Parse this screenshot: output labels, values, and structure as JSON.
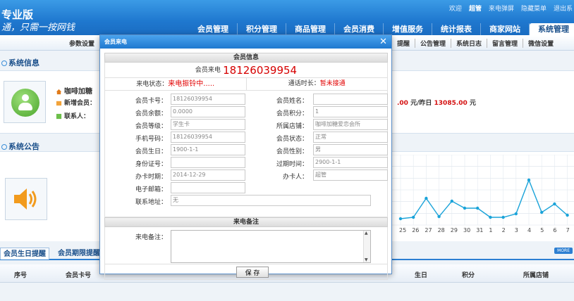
{
  "header": {
    "edition": "专业版",
    "slogan": "通，只需一按网钱",
    "top_links": {
      "welcome": "欢迎",
      "user": "超管",
      "call_popup": "来电弹屏",
      "hide_menu": "隐藏菜单",
      "logout": "退出系"
    },
    "nav": [
      "会员管理",
      "积分管理",
      "商品管理",
      "会员消费",
      "增值服务",
      "统计报表",
      "商家网站",
      "系统管理"
    ],
    "active_nav": "系统管理"
  },
  "subnav": {
    "left": "参数设置",
    "right": [
      "提醒",
      "公告管理",
      "系统日志",
      "留言管理",
      "微信设置"
    ]
  },
  "system_info": {
    "title": "系统信息",
    "shop_name": "咖啡加糖",
    "new_member_label": "新增会员：",
    "contact_label": "联系人：",
    "sales_today_tail": ".00",
    "sales_yesterday_label": "元/昨日",
    "sales_yesterday": "13085.00",
    "currency": "元"
  },
  "announcement": {
    "title": "系统公告"
  },
  "chart_data": {
    "type": "line",
    "x": [
      "25",
      "26",
      "27",
      "28",
      "29",
      "30",
      "31",
      "1",
      "2",
      "3",
      "4",
      "5",
      "6",
      "7"
    ],
    "values": [
      9,
      11,
      38,
      12,
      34,
      24,
      24,
      11,
      11,
      16,
      64,
      18,
      30,
      14
    ],
    "ylim": [
      0,
      100
    ],
    "color": "#1aa3d9",
    "grid": true
  },
  "bottom": {
    "tabs": [
      "会员生日提醒",
      "会员期限提醒"
    ],
    "more_badge": "MORE",
    "columns": [
      "序号",
      "会员卡号",
      "生日",
      "积分",
      "所属店铺"
    ]
  },
  "modal": {
    "title": "会员来电",
    "close_symbol": "✕",
    "section_member": "会员信息",
    "caller_label": "会员来电",
    "caller_number": "18126039954",
    "call_status_label": "来电状态：",
    "call_status": "来电振铃中.....",
    "duration_label": "通话时长：",
    "duration": "暂未接通",
    "fields": {
      "card_no": {
        "label": "会员卡号：",
        "value": "18126039954"
      },
      "name": {
        "label": "会员姓名：",
        "value": ""
      },
      "balance": {
        "label": "会员余额：",
        "value": "0.0000"
      },
      "points": {
        "label": "会员积分：",
        "value": "1"
      },
      "level": {
        "label": "会员等级：",
        "value": "学生卡"
      },
      "shop": {
        "label": "所属店铺：",
        "value": "咖啡加糖爱恋会所"
      },
      "phone": {
        "label": "手机号码：",
        "value": "18126039954"
      },
      "status": {
        "label": "会员状态：",
        "value": "正常"
      },
      "birthday": {
        "label": "会员生日：",
        "value": "1900-1-1"
      },
      "gender": {
        "label": "会员性别：",
        "value": "男"
      },
      "id_no": {
        "label": "身份证号：",
        "value": ""
      },
      "expire": {
        "label": "过期时间：",
        "value": "2900-1-1"
      },
      "issue_date": {
        "label": "办卡时期：",
        "value": "2014-12-29"
      },
      "issuer": {
        "label": "办卡人：",
        "value": "超管"
      },
      "email": {
        "label": "电子邮箱：",
        "value": ""
      },
      "address": {
        "label": "联系地址：",
        "value": "无"
      }
    },
    "section_remark": "来电备注",
    "remark_label": "来电备注：",
    "save_label": "保 存"
  }
}
